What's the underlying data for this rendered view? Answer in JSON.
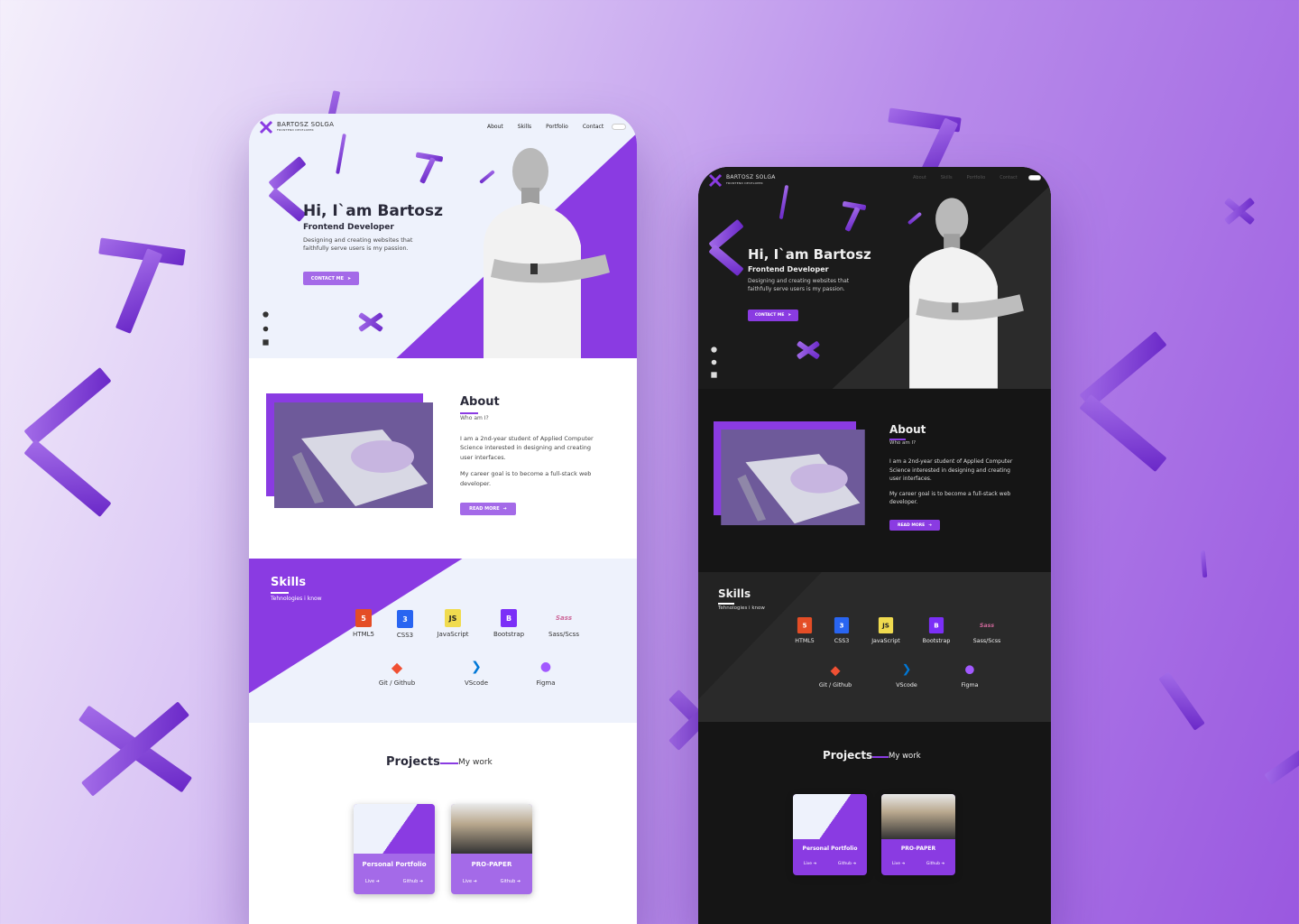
{
  "brand": {
    "name": "BARTOSZ SOLGA",
    "tagline": "FRONTEND DEVELOPER"
  },
  "nav": {
    "links": [
      "About",
      "Skills",
      "Portfolio",
      "Contact"
    ]
  },
  "hero": {
    "title": "Hi, I`am Bartosz",
    "subtitle": "Frontend Developer",
    "description_line1": "Designing and creating websites that",
    "description_line2": "faithfully serve users is my passion.",
    "cta": "CONTACT ME"
  },
  "social": [
    "github-icon",
    "info-icon",
    "linkedin-icon"
  ],
  "about": {
    "title": "About",
    "subtitle": "Who am I?",
    "p1_line1": "I am a 2nd-year student of Applied Computer",
    "p1_line2": "Science interested in designing and creating",
    "p1_line3": "user interfaces.",
    "p2_line1": "My career goal is to become a full-stack web",
    "p2_line2": "developer.",
    "button": "READ MORE"
  },
  "skills": {
    "title": "Skills",
    "subtitle": "Tehnologies i know",
    "items": [
      {
        "label": "HTML5",
        "icon": "html5-icon",
        "glyph": "5",
        "color": "#e44d26"
      },
      {
        "label": "CSS3",
        "icon": "css3-icon",
        "glyph": "3",
        "color": "#2965f1"
      },
      {
        "label": "JavaScript",
        "icon": "javascript-icon",
        "glyph": "JS",
        "color": "#f0db4f"
      },
      {
        "label": "Bootstrap",
        "icon": "bootstrap-icon",
        "glyph": "B",
        "color": "#7b2ff7"
      },
      {
        "label": "Sass/Scss",
        "icon": "sass-icon",
        "glyph": "Sass",
        "color": "#cd6799"
      },
      {
        "label": "Git / Github",
        "icon": "git-icon",
        "glyph": "◆",
        "color": "#f05033"
      },
      {
        "label": "VScode",
        "icon": "vscode-icon",
        "glyph": "❯",
        "color": "#0078d7"
      },
      {
        "label": "Figma",
        "icon": "figma-icon",
        "glyph": "●",
        "color": "#a259ff"
      }
    ]
  },
  "projects": {
    "title": "Projects",
    "subtitle": "My work",
    "items": [
      {
        "name": "Personal Portfolio",
        "live": "Live ➔",
        "github": "Github ➔"
      },
      {
        "name": "PRO-PAPER",
        "live": "Live ➔",
        "github": "Github ➔"
      }
    ]
  },
  "colors": {
    "accent": "#8a3be2",
    "light_bg": "#eef2fc",
    "dark_bg": "#151515",
    "dark_panel": "#2a2a2a"
  }
}
